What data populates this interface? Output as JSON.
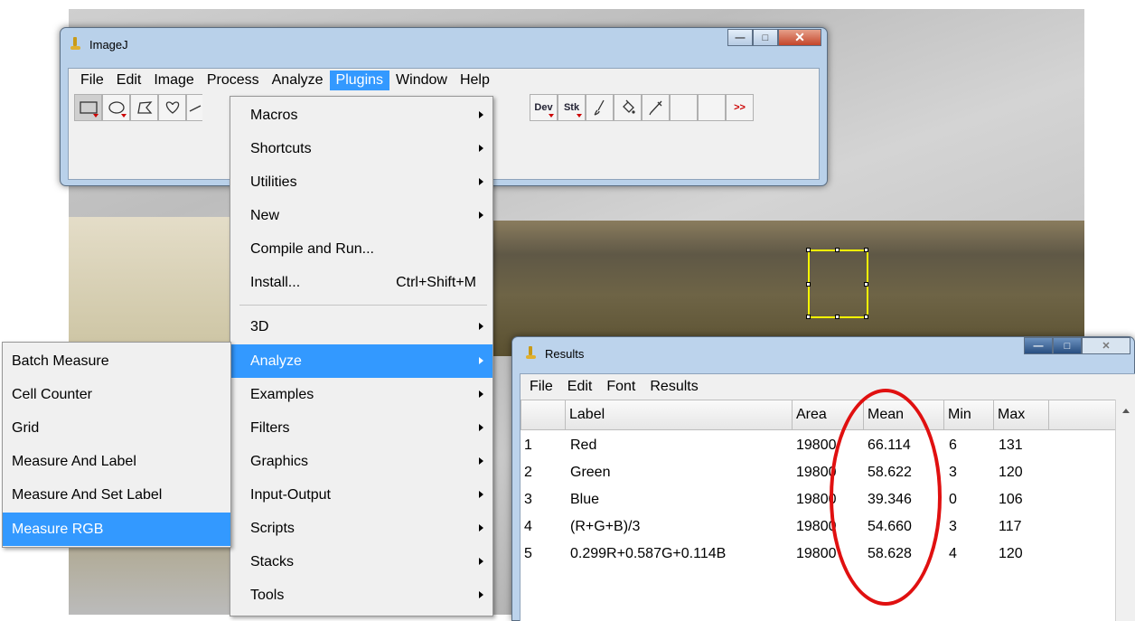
{
  "imagej": {
    "title": "ImageJ",
    "menubar": [
      "File",
      "Edit",
      "Image",
      "Process",
      "Analyze",
      "Plugins",
      "Window",
      "Help"
    ],
    "active_menu": "Plugins",
    "toolbar": {
      "dev_label": "Dev",
      "stk_label": "Stk",
      "more_label": ">>"
    }
  },
  "plugins_menu": {
    "items": [
      {
        "label": "Macros",
        "submenu": true
      },
      {
        "label": "Shortcuts",
        "submenu": true
      },
      {
        "label": "Utilities",
        "submenu": true
      },
      {
        "label": "New",
        "submenu": true
      },
      {
        "label": "Compile and Run...",
        "submenu": false
      },
      {
        "label": "Install...",
        "shortcut": "Ctrl+Shift+M",
        "submenu": false
      },
      {
        "label": "3D",
        "submenu": true
      },
      {
        "label": "Analyze",
        "submenu": true,
        "highlighted": true
      },
      {
        "label": "Examples",
        "submenu": true
      },
      {
        "label": "Filters",
        "submenu": true
      },
      {
        "label": "Graphics",
        "submenu": true
      },
      {
        "label": "Input-Output",
        "submenu": true
      },
      {
        "label": "Scripts",
        "submenu": true
      },
      {
        "label": "Stacks",
        "submenu": true
      },
      {
        "label": "Tools",
        "submenu": true
      }
    ]
  },
  "analyze_submenu": {
    "items": [
      {
        "label": "Batch Measure"
      },
      {
        "label": "Cell Counter"
      },
      {
        "label": "Grid"
      },
      {
        "label": "Measure And Label"
      },
      {
        "label": "Measure And Set Label"
      },
      {
        "label": "Measure RGB",
        "highlighted": true
      }
    ]
  },
  "results": {
    "title": "Results",
    "menubar": [
      "File",
      "Edit",
      "Font",
      "Results"
    ],
    "columns": [
      "",
      "Label",
      "Area",
      "Mean",
      "Min",
      "Max"
    ],
    "rows": [
      [
        "1",
        "Red",
        "19800",
        "66.114",
        "6",
        "131"
      ],
      [
        "2",
        "Green",
        "19800",
        "58.622",
        "3",
        "120"
      ],
      [
        "3",
        "Blue",
        "19800",
        "39.346",
        "0",
        "106"
      ],
      [
        "4",
        "(R+G+B)/3",
        "19800",
        "54.660",
        "3",
        "117"
      ],
      [
        "5",
        "0.299R+0.587G+0.114B",
        "19800",
        "58.628",
        "4",
        "120"
      ]
    ]
  },
  "colors": {
    "menu_highlight": "#3399ff",
    "roi": "#f5f500",
    "annotation": "#e01010"
  }
}
